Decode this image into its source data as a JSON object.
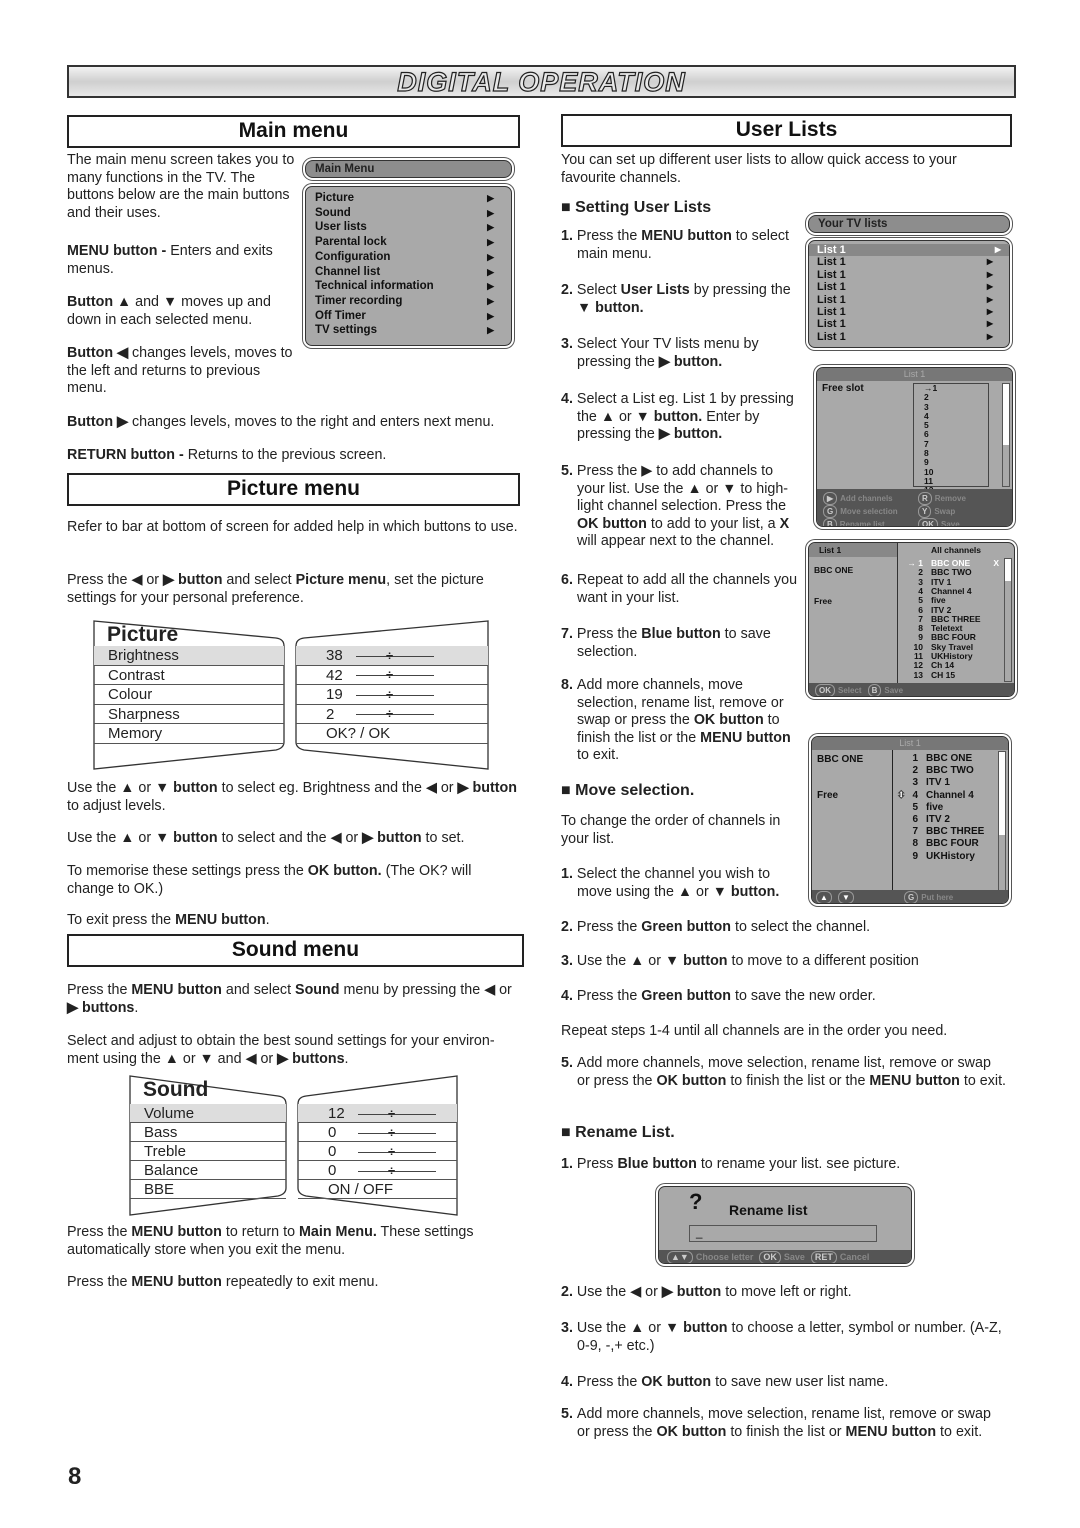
{
  "title": "DIGITAL OPERATION",
  "page_number": "8",
  "main_menu": {
    "heading": "Main menu",
    "paras": [
      [
        {
          "t": "The main menu screen takes you to many functions in the TV. The buttons below are the main buttons and their uses."
        }
      ],
      [
        {
          "t": "MENU button -",
          "b": true
        },
        {
          "t": " Enters and exits menus."
        }
      ],
      [
        {
          "t": "Button ▲",
          "b": true
        },
        {
          "t": " and "
        },
        {
          "t": "▼",
          "b": true
        },
        {
          "t": " moves up and down in each selected menu."
        }
      ],
      [
        {
          "t": "Button ◀",
          "b": true
        },
        {
          "t": " changes levels, moves to the left and returns to previous menu."
        }
      ],
      [
        {
          "t": "Button ▶",
          "b": true
        },
        {
          "t": " changes levels, moves to the right and enters next menu."
        }
      ],
      [
        {
          "t": "RETURN button -",
          "b": true
        },
        {
          "t": " Returns to the previous screen."
        }
      ]
    ],
    "screen": {
      "title": "Main Menu",
      "items": [
        "Picture",
        "Sound",
        "User lists",
        "Parental lock",
        "Configuration",
        "Channel list",
        "Technical information",
        "Timer recording",
        "Off Timer",
        "TV settings"
      ]
    }
  },
  "picture_menu": {
    "heading": "Picture menu",
    "paras": [
      [
        {
          "t": "Refer to bar at bottom of screen for added help in which buttons to use."
        }
      ],
      [
        {
          "t": "Press the ◀ or "
        },
        {
          "t": "▶ button",
          "b": true
        },
        {
          "t": " and select "
        },
        {
          "t": "Picture menu",
          "b": true
        },
        {
          "t": ", set the picture settings for your personal preference."
        }
      ],
      [
        {
          "t": "Use the ▲ or "
        },
        {
          "t": "▼ button",
          "b": true
        },
        {
          "t": " to select eg. Brightness and the ◀ or "
        },
        {
          "t": "▶ button",
          "b": true
        },
        {
          "t": " to adjust levels."
        }
      ],
      [
        {
          "t": "Use the ▲ or "
        },
        {
          "t": "▼ button",
          "b": true
        },
        {
          "t": " to select and the ◀ or "
        },
        {
          "t": "▶ button",
          "b": true
        },
        {
          "t": " to set."
        }
      ],
      [
        {
          "t": "To memorise these settings press the "
        },
        {
          "t": "OK button.",
          "b": true
        },
        {
          "t": " (The OK? will change to OK.)"
        }
      ],
      [
        {
          "t": "To exit press the "
        },
        {
          "t": "MENU button",
          "b": true
        },
        {
          "t": "."
        }
      ]
    ],
    "screen": {
      "title": "Picture",
      "rows": [
        {
          "label": "Brightness",
          "value": "38",
          "slider": true
        },
        {
          "label": "Contrast",
          "value": "42",
          "slider": true
        },
        {
          "label": "Colour",
          "value": "19",
          "slider": true
        },
        {
          "label": "Sharpness",
          "value": "2",
          "slider": true
        },
        {
          "label": "Memory",
          "value": "OK?  /  OK",
          "slider": false
        }
      ]
    }
  },
  "sound_menu": {
    "heading": "Sound menu",
    "paras": [
      [
        {
          "t": "Press the "
        },
        {
          "t": "MENU button",
          "b": true
        },
        {
          "t": " and select "
        },
        {
          "t": "Sound",
          "b": true
        },
        {
          "t": " menu by pressing the ◀ or "
        },
        {
          "t": "▶ buttons",
          "b": true
        },
        {
          "t": "."
        }
      ],
      [
        {
          "t": "Select and adjust to obtain the best sound settings for your environ-ment using the ▲ or ▼ and ◀ or "
        },
        {
          "t": "▶ buttons",
          "b": true
        },
        {
          "t": "."
        }
      ],
      [
        {
          "t": "Press the "
        },
        {
          "t": "MENU button",
          "b": true
        },
        {
          "t": " to return to "
        },
        {
          "t": "Main Menu.",
          "b": true
        },
        {
          "t": " These settings automatically store when you exit the menu."
        }
      ],
      [
        {
          "t": "Press the "
        },
        {
          "t": "MENU button",
          "b": true
        },
        {
          "t": " repeatedly to exit menu."
        }
      ]
    ],
    "screen": {
      "title": "Sound",
      "rows": [
        {
          "label": "Volume",
          "value": "12",
          "slider": true
        },
        {
          "label": "Bass",
          "value": "0",
          "slider": true
        },
        {
          "label": "Treble",
          "value": "0",
          "slider": true
        },
        {
          "label": "Balance",
          "value": "0",
          "slider": true
        },
        {
          "label": "BBE",
          "value": "ON / OFF",
          "slider": false
        }
      ]
    }
  },
  "user_lists": {
    "heading": "User Lists",
    "intro": [
      {
        "t": "You can set up different user lists to allow quick access to your favourite channels."
      }
    ],
    "setting_heading": "■ Setting User Lists",
    "setting_steps": [
      [
        {
          "t": "1. ",
          "b": true
        },
        {
          "t": "Press the "
        },
        {
          "t": "MENU button",
          "b": true
        },
        {
          "t": " to select main menu."
        }
      ],
      [
        {
          "t": "2. ",
          "b": true
        },
        {
          "t": "Select "
        },
        {
          "t": "User Lists",
          "b": true
        },
        {
          "t": " by pressing the "
        },
        {
          "t": "▼ button.",
          "b": true
        }
      ],
      [
        {
          "t": "3. ",
          "b": true
        },
        {
          "t": "Select Your TV lists menu by pressing the "
        },
        {
          "t": "▶ button.",
          "b": true
        }
      ],
      [
        {
          "t": "4. ",
          "b": true
        },
        {
          "t": "Select a List eg. List 1 by pressing the ▲ or "
        },
        {
          "t": "▼ button.",
          "b": true
        },
        {
          "t": " Enter by pressing the  "
        },
        {
          "t": "▶ button.",
          "b": true
        }
      ],
      [
        {
          "t": "5. ",
          "b": true
        },
        {
          "t": "Press the ▶ to add channels to your list. Use the ▲ or ▼ to high-light channel selection. Press the "
        },
        {
          "t": "OK button",
          "b": true
        },
        {
          "t": " to add to your list, a "
        },
        {
          "t": "X",
          "b": true
        },
        {
          "t": " will appear next to the channel."
        }
      ],
      [
        {
          "t": "6. ",
          "b": true
        },
        {
          "t": "Repeat to add all the channels you want in your list."
        }
      ],
      [
        {
          "t": "7. ",
          "b": true
        },
        {
          "t": "Press the "
        },
        {
          "t": "Blue button",
          "b": true
        },
        {
          "t": " to save selection."
        }
      ],
      [
        {
          "t": "8. ",
          "b": true
        },
        {
          "t": "Add more channels, move selection, rename list, remove or swap or press the "
        },
        {
          "t": "OK button",
          "b": true
        },
        {
          "t": " to finish the list or the "
        },
        {
          "t": "MENU button",
          "b": true
        },
        {
          "t": " to exit."
        }
      ]
    ],
    "move_heading": "■ Move selection.",
    "move_intro": [
      {
        "t": "To change the order of channels in your list."
      }
    ],
    "move_step1": [
      {
        "t": "1. ",
        "b": true
      },
      {
        "t": "Select the channel you wish to move using the ▲ or "
      },
      {
        "t": "▼ button.",
        "b": true
      }
    ],
    "move_steps": [
      [
        {
          "t": "2. ",
          "b": true
        },
        {
          "t": "Press the "
        },
        {
          "t": "Green button",
          "b": true
        },
        {
          "t": " to select  the channel."
        }
      ],
      [
        {
          "t": "3. ",
          "b": true
        },
        {
          "t": "Use the ▲ or "
        },
        {
          "t": "▼ button",
          "b": true
        },
        {
          "t": " to move to a different position"
        }
      ],
      [
        {
          "t": "4. ",
          "b": true
        },
        {
          "t": "Press the "
        },
        {
          "t": "Green button",
          "b": true
        },
        {
          "t": " to save the new order."
        }
      ],
      [
        {
          "t": "Repeat steps 1-4 until all channels are in the order you need."
        }
      ],
      [
        {
          "t": "5. ",
          "b": true
        },
        {
          "t": "Add more channels, move selection, rename list, remove or swap or press the "
        },
        {
          "t": "OK button",
          "b": true
        },
        {
          "t": " to finish the list or the "
        },
        {
          "t": "MENU button",
          "b": true
        },
        {
          "t": " to exit."
        }
      ]
    ],
    "rename_heading": "■ Rename List.",
    "rename_step1": [
      {
        "t": "1. ",
        "b": true
      },
      {
        "t": "Press "
      },
      {
        "t": "Blue button",
        "b": true
      },
      {
        "t": " to rename your list. see picture."
      }
    ],
    "rename_steps": [
      [
        {
          "t": "2. ",
          "b": true
        },
        {
          "t": "Use the ◀ or "
        },
        {
          "t": "▶ button",
          "b": true
        },
        {
          "t": " to move left or right."
        }
      ],
      [
        {
          "t": "3. ",
          "b": true
        },
        {
          "t": "Use the ▲ or "
        },
        {
          "t": "▼ button",
          "b": true
        },
        {
          "t": " to choose a letter, symbol or number. (A-Z, 0-9, -,+ etc.)"
        }
      ],
      [
        {
          "t": "4. ",
          "b": true
        },
        {
          "t": "Press the "
        },
        {
          "t": "OK button",
          "b": true
        },
        {
          "t": " to save new user list name."
        }
      ],
      [
        {
          "t": "5. ",
          "b": true
        },
        {
          "t": "Add more channels, move selection, rename list, remove or swap or press the "
        },
        {
          "t": "OK button",
          "b": true
        },
        {
          "t": " to finish the list or "
        },
        {
          "t": "MENU button",
          "b": true
        },
        {
          "t": " to exit."
        }
      ]
    ],
    "tv_lists_screen": {
      "title": "Your TV lists",
      "items": [
        "List 1",
        "List 1",
        "List 1",
        "List 1",
        "List 1",
        "List 1",
        "List 1",
        "List 1"
      ]
    },
    "free_slot_screen": {
      "title": "List 1",
      "left": "Free slot",
      "numbers": [
        "1",
        "2",
        "3",
        "4",
        "5",
        "6",
        "7",
        "8",
        "9",
        "10",
        "11",
        "12"
      ],
      "help": [
        {
          "key": "▶",
          "label": "Add channels"
        },
        {
          "key": "R",
          "label": "Remove"
        },
        {
          "key": "G",
          "label": "Move selection"
        },
        {
          "key": "Y",
          "label": "Swap"
        },
        {
          "key": "B",
          "label": "Rename list"
        },
        {
          "key": "OK",
          "label": "Save"
        }
      ]
    },
    "all_channels_screen": {
      "left_title": "List 1",
      "right_title": "All channels",
      "left_items": [
        "BBC ONE",
        "Free"
      ],
      "channels": [
        [
          "1",
          "BBC ONE"
        ],
        [
          "2",
          "BBC TWO"
        ],
        [
          "3",
          "ITV 1"
        ],
        [
          "4",
          "Channel 4"
        ],
        [
          "5",
          "five"
        ],
        [
          "6",
          "ITV 2"
        ],
        [
          "7",
          "BBC THREE"
        ],
        [
          "8",
          "Teletext"
        ],
        [
          "9",
          "BBC FOUR"
        ],
        [
          "10",
          "Sky Travel"
        ],
        [
          "11",
          "UKHistory"
        ],
        [
          "12",
          "Ch 14"
        ],
        [
          "13",
          "CH 15"
        ]
      ],
      "mark": "X",
      "help": [
        {
          "key": "OK",
          "label": "Select"
        },
        {
          "key": "B",
          "label": "Save"
        }
      ]
    },
    "move_screen": {
      "title": "List 1",
      "left_items": [
        "BBC ONE",
        "Free"
      ],
      "channels": [
        [
          "1",
          "BBC ONE"
        ],
        [
          "2",
          "BBC TWO"
        ],
        [
          "3",
          "ITV 1"
        ],
        [
          "4",
          "Channel 4"
        ],
        [
          "5",
          "five"
        ],
        [
          "6",
          "ITV 2"
        ],
        [
          "7",
          "BBC THREE"
        ],
        [
          "8",
          "BBC FOUR"
        ],
        [
          "9",
          "UKHistory"
        ]
      ],
      "help": [
        {
          "key": "G",
          "label": "Put here"
        }
      ]
    },
    "rename_screen": {
      "icon": "?",
      "title": "Rename list",
      "value": "_",
      "help": [
        {
          "key": "▲▼",
          "label": "Choose letter"
        },
        {
          "key": "OK",
          "label": "Save"
        },
        {
          "key": "RET",
          "label": "Cancel"
        }
      ]
    }
  }
}
